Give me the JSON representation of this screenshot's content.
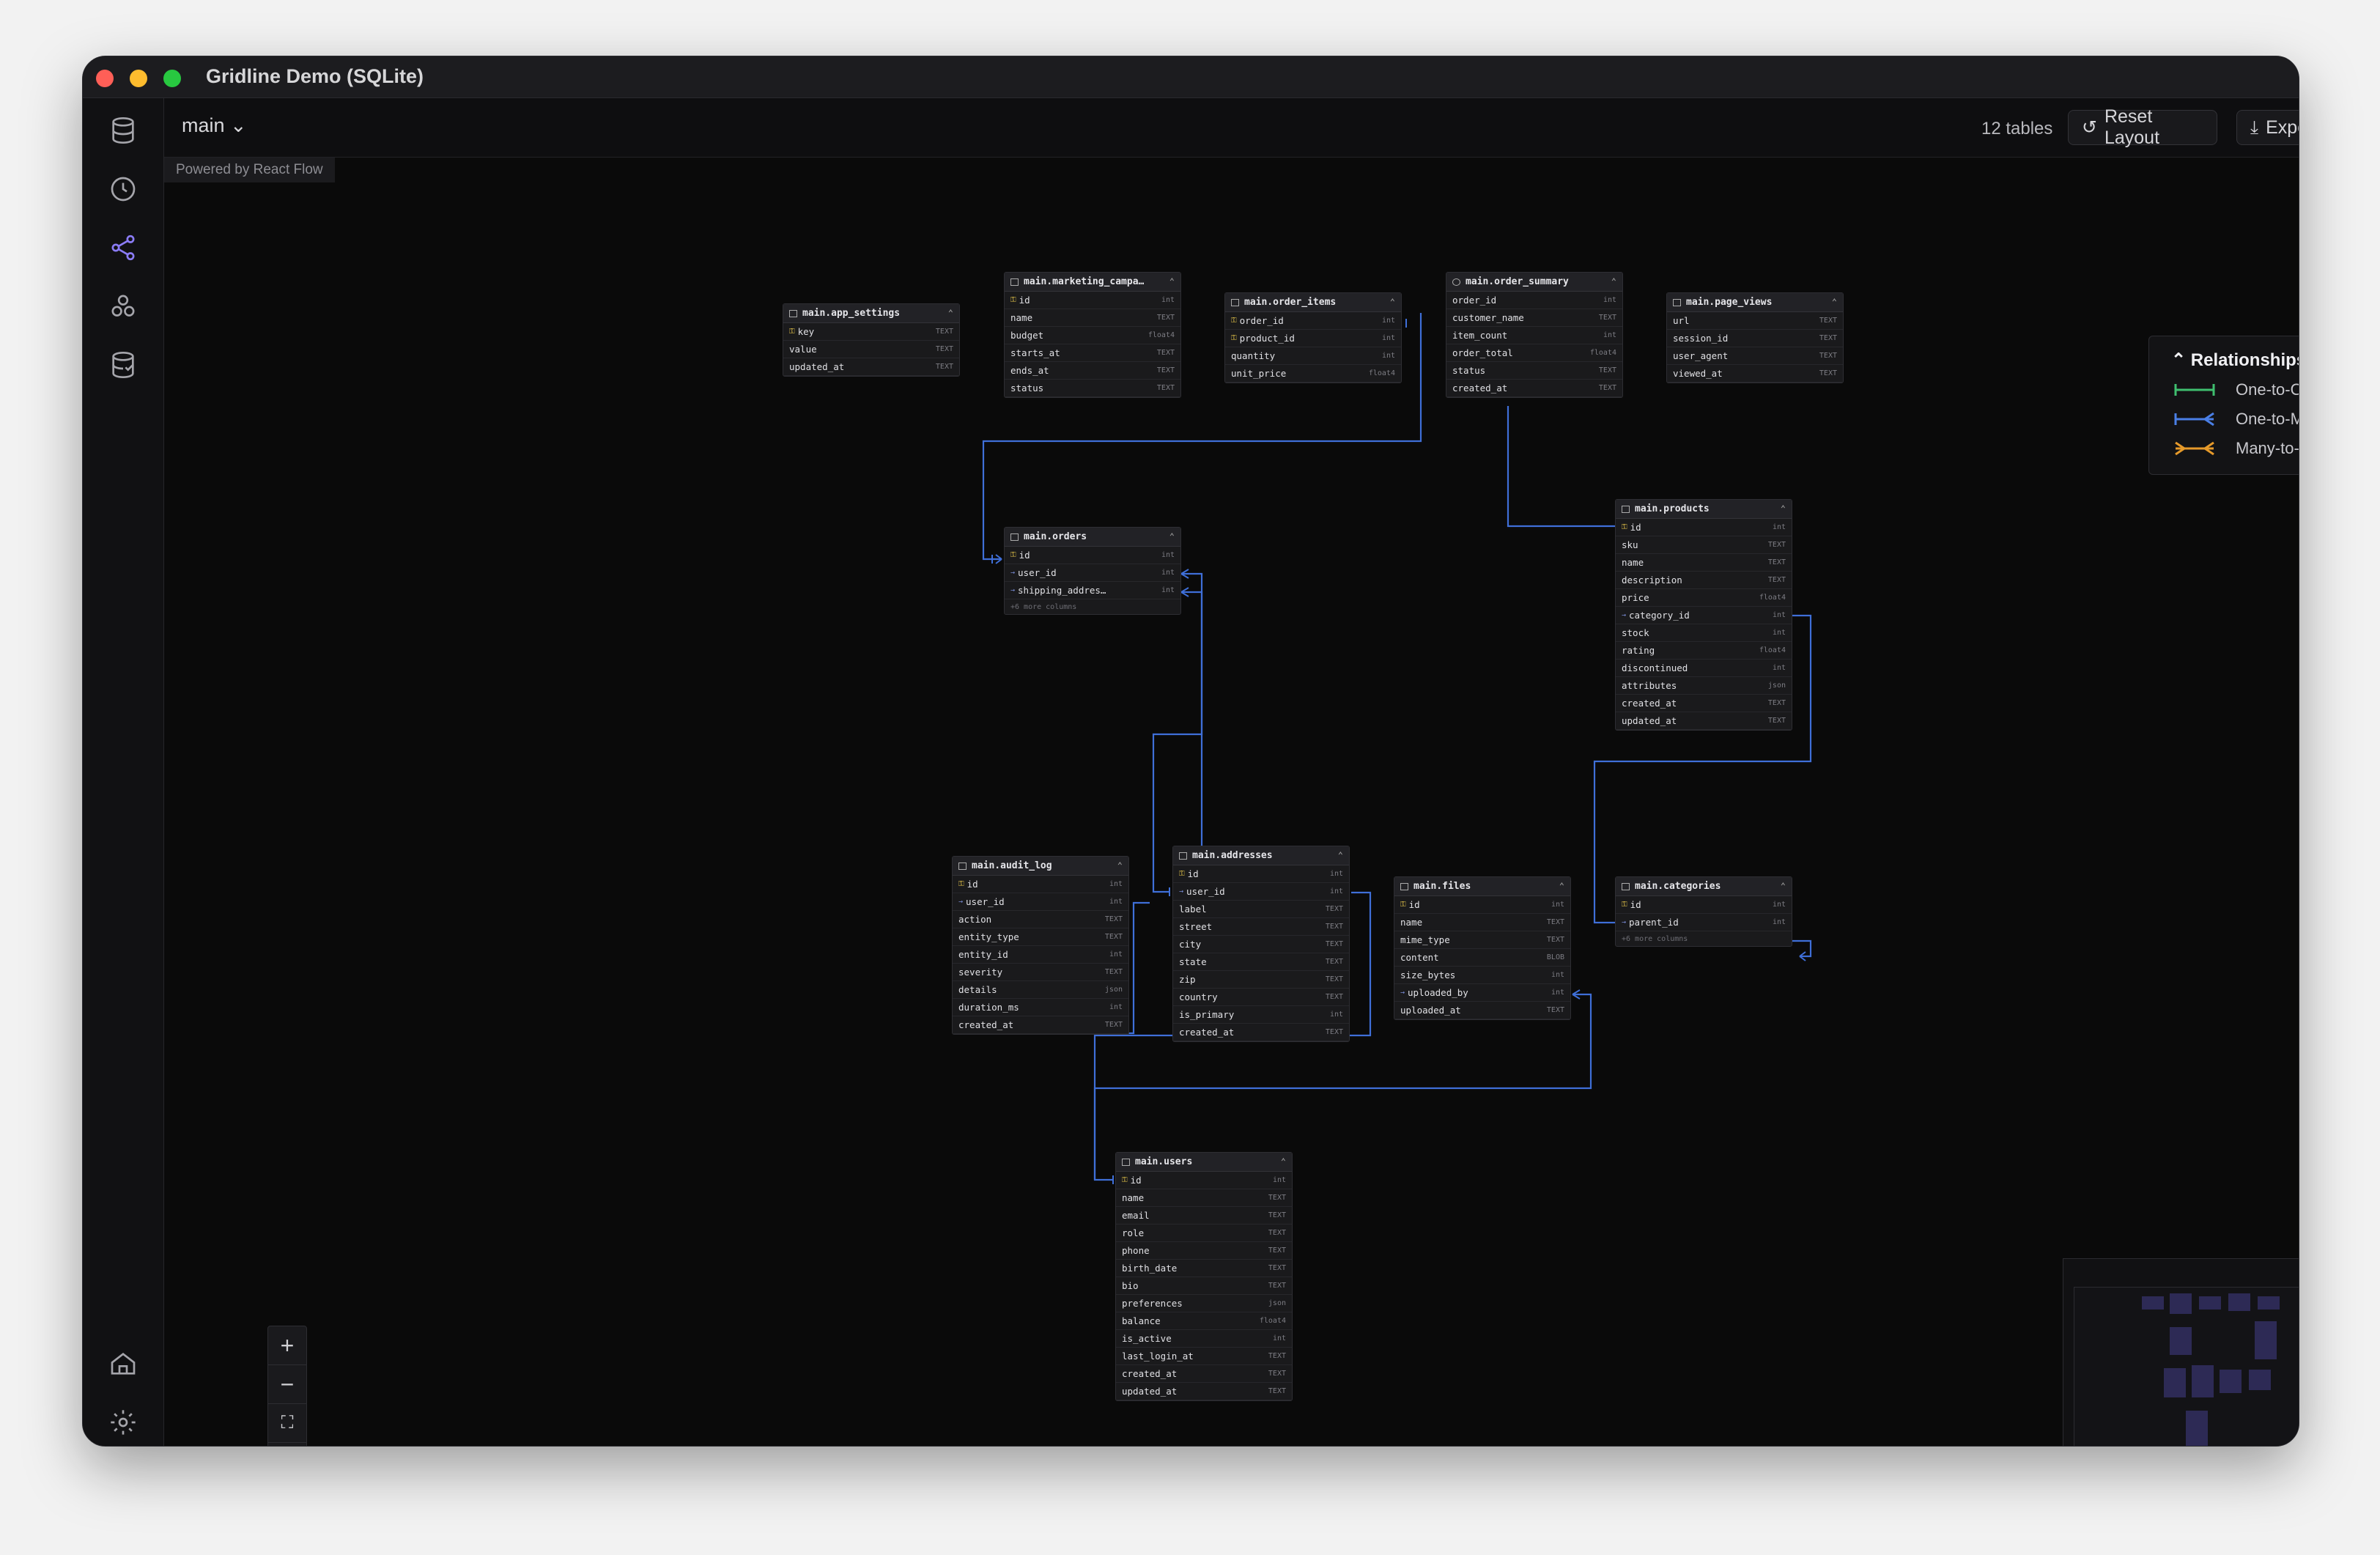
{
  "window": {
    "title": "Gridline Demo (SQLite)"
  },
  "toolbar": {
    "schema": "main",
    "table_count": "12 tables",
    "reset_label": "Reset Layout",
    "export_label": "Export"
  },
  "canvas": {
    "attribution": "Powered by React Flow"
  },
  "legend": {
    "title": "Relationships",
    "items": [
      {
        "label": "One-to-One",
        "color": "#3fbf6f"
      },
      {
        "label": "One-to-Many",
        "color": "#4a7fe6"
      },
      {
        "label": "Many-to-Many",
        "color": "#e69a2a"
      }
    ]
  },
  "tables": {
    "app_settings": {
      "name": "main.app_settings",
      "columns": [
        {
          "name": "key",
          "type": "TEXT"
        },
        {
          "name": "value",
          "type": "TEXT"
        },
        {
          "name": "updated_at",
          "type": "TEXT"
        }
      ]
    },
    "marketing": {
      "name": "main.marketing_campa…",
      "columns": [
        {
          "name": "id",
          "type": "int"
        },
        {
          "name": "name",
          "type": "TEXT"
        },
        {
          "name": "budget",
          "type": "float4"
        },
        {
          "name": "starts_at",
          "type": "TEXT"
        },
        {
          "name": "ends_at",
          "type": "TEXT"
        },
        {
          "name": "status",
          "type": "TEXT"
        }
      ]
    },
    "order_items": {
      "name": "main.order_items",
      "columns": [
        {
          "name": "order_id",
          "type": "int"
        },
        {
          "name": "product_id",
          "type": "int"
        },
        {
          "name": "quantity",
          "type": "int"
        },
        {
          "name": "unit_price",
          "type": "float4"
        }
      ]
    },
    "order_summary": {
      "name": "main.order_summary",
      "columns": [
        {
          "name": "order_id",
          "type": "int"
        },
        {
          "name": "customer_name",
          "type": "TEXT"
        },
        {
          "name": "item_count",
          "type": "int"
        },
        {
          "name": "order_total",
          "type": "float4"
        },
        {
          "name": "status",
          "type": "TEXT"
        },
        {
          "name": "created_at",
          "type": "TEXT"
        }
      ]
    },
    "page_views": {
      "name": "main.page_views",
      "columns": [
        {
          "name": "url",
          "type": "TEXT"
        },
        {
          "name": "session_id",
          "type": "TEXT"
        },
        {
          "name": "user_agent",
          "type": "TEXT"
        },
        {
          "name": "viewed_at",
          "type": "TEXT"
        }
      ]
    },
    "orders": {
      "name": "main.orders",
      "more": "+6 more columns",
      "columns": [
        {
          "name": "id",
          "type": "int"
        },
        {
          "name": "user_id",
          "type": "int"
        },
        {
          "name": "shipping_addres…",
          "type": "int"
        }
      ]
    },
    "products": {
      "name": "main.products",
      "columns": [
        {
          "name": "id",
          "type": "int"
        },
        {
          "name": "sku",
          "type": "TEXT"
        },
        {
          "name": "name",
          "type": "TEXT"
        },
        {
          "name": "description",
          "type": "TEXT"
        },
        {
          "name": "price",
          "type": "float4"
        },
        {
          "name": "category_id",
          "type": "int"
        },
        {
          "name": "stock",
          "type": "int"
        },
        {
          "name": "rating",
          "type": "float4"
        },
        {
          "name": "discontinued",
          "type": "int"
        },
        {
          "name": "attributes",
          "type": "json"
        },
        {
          "name": "created_at",
          "type": "TEXT"
        },
        {
          "name": "updated_at",
          "type": "TEXT"
        }
      ]
    },
    "audit_log": {
      "name": "main.audit_log",
      "columns": [
        {
          "name": "id",
          "type": "int"
        },
        {
          "name": "user_id",
          "type": "int"
        },
        {
          "name": "action",
          "type": "TEXT"
        },
        {
          "name": "entity_type",
          "type": "TEXT"
        },
        {
          "name": "entity_id",
          "type": "int"
        },
        {
          "name": "severity",
          "type": "TEXT"
        },
        {
          "name": "details",
          "type": "json"
        },
        {
          "name": "duration_ms",
          "type": "int"
        },
        {
          "name": "created_at",
          "type": "TEXT"
        }
      ]
    },
    "addresses": {
      "name": "main.addresses",
      "columns": [
        {
          "name": "id",
          "type": "int"
        },
        {
          "name": "user_id",
          "type": "int"
        },
        {
          "name": "label",
          "type": "TEXT"
        },
        {
          "name": "street",
          "type": "TEXT"
        },
        {
          "name": "city",
          "type": "TEXT"
        },
        {
          "name": "state",
          "type": "TEXT"
        },
        {
          "name": "zip",
          "type": "TEXT"
        },
        {
          "name": "country",
          "type": "TEXT"
        },
        {
          "name": "is_primary",
          "type": "int"
        },
        {
          "name": "created_at",
          "type": "TEXT"
        }
      ]
    },
    "files": {
      "name": "main.files",
      "columns": [
        {
          "name": "id",
          "type": "int"
        },
        {
          "name": "name",
          "type": "TEXT"
        },
        {
          "name": "mime_type",
          "type": "TEXT"
        },
        {
          "name": "content",
          "type": "BLOB"
        },
        {
          "name": "size_bytes",
          "type": "int"
        },
        {
          "name": "uploaded_by",
          "type": "int"
        },
        {
          "name": "uploaded_at",
          "type": "TEXT"
        }
      ]
    },
    "categories": {
      "name": "main.categories",
      "more": "+6 more columns",
      "columns": [
        {
          "name": "id",
          "type": "int"
        },
        {
          "name": "parent_id",
          "type": "int"
        }
      ]
    },
    "users": {
      "name": "main.users",
      "columns": [
        {
          "name": "id",
          "type": "int"
        },
        {
          "name": "name",
          "type": "TEXT"
        },
        {
          "name": "email",
          "type": "TEXT"
        },
        {
          "name": "role",
          "type": "TEXT"
        },
        {
          "name": "phone",
          "type": "TEXT"
        },
        {
          "name": "birth_date",
          "type": "TEXT"
        },
        {
          "name": "bio",
          "type": "TEXT"
        },
        {
          "name": "preferences",
          "type": "json"
        },
        {
          "name": "balance",
          "type": "float4"
        },
        {
          "name": "is_active",
          "type": "int"
        },
        {
          "name": "last_login_at",
          "type": "TEXT"
        },
        {
          "name": "created_at",
          "type": "TEXT"
        },
        {
          "name": "updated_at",
          "type": "TEXT"
        }
      ]
    }
  }
}
